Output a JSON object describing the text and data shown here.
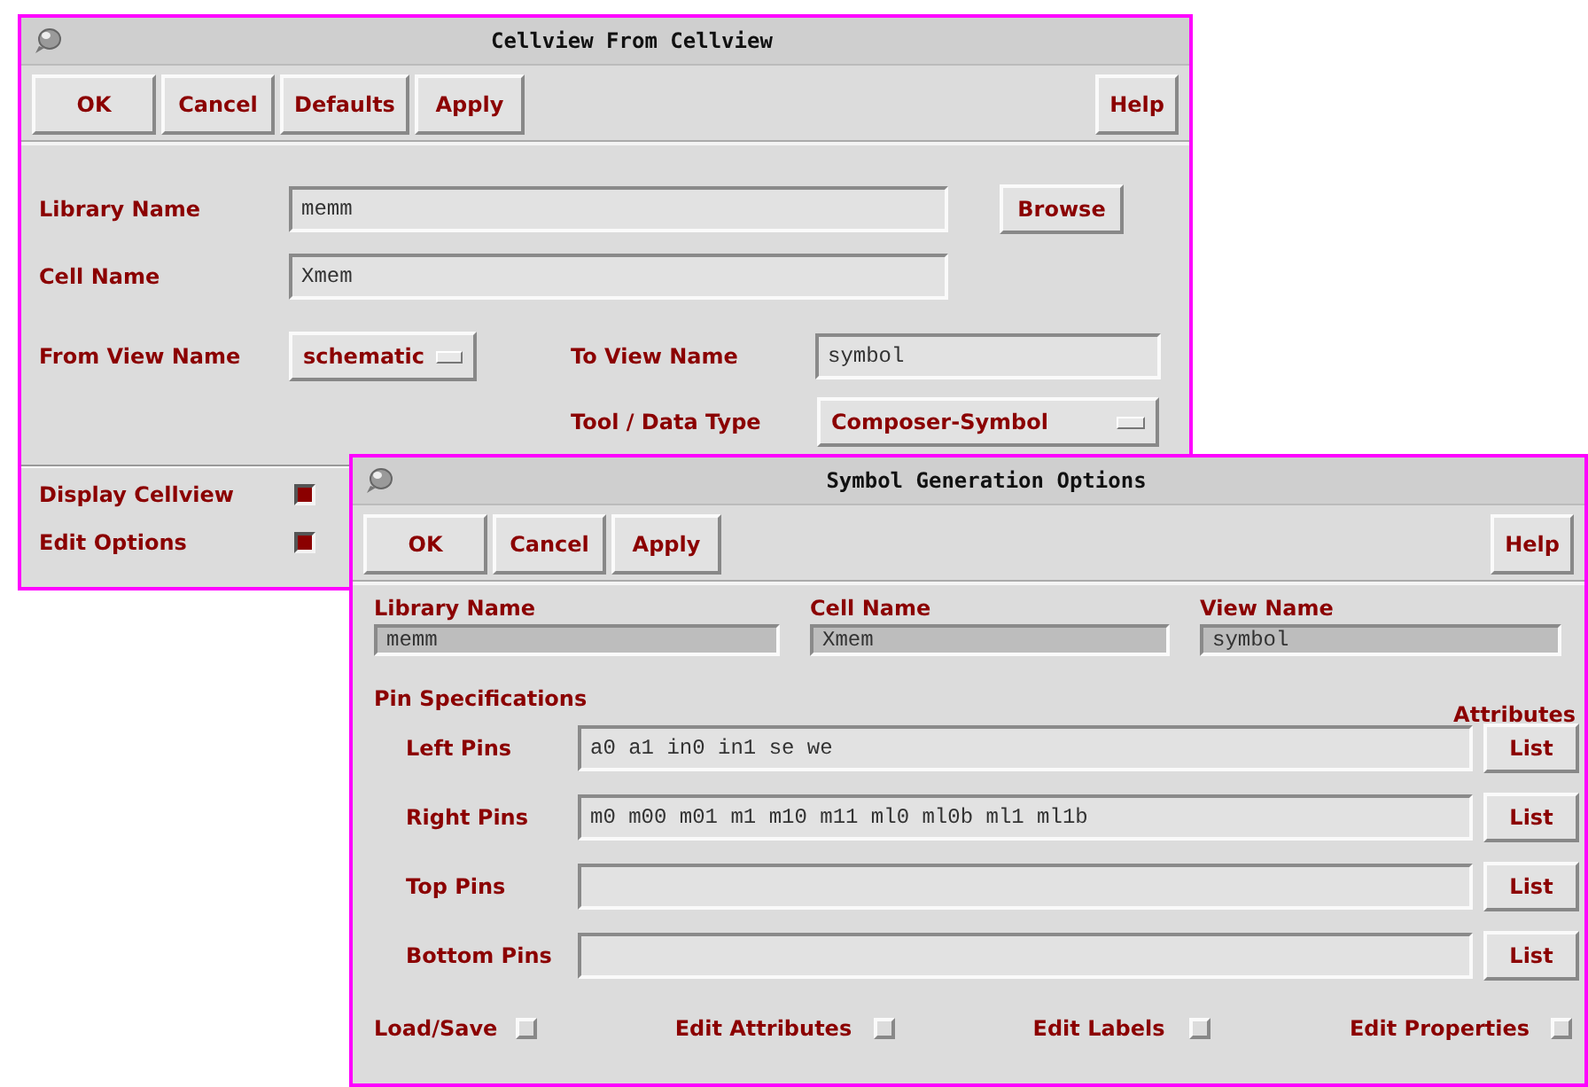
{
  "cellview_dialog": {
    "title": "Cellview From Cellview",
    "buttons": [
      "OK",
      "Cancel",
      "Defaults",
      "Apply"
    ],
    "help_button": "Help",
    "library_name": {
      "label": "Library Name",
      "value": "memm"
    },
    "browse_button": "Browse",
    "cell_name": {
      "label": "Cell Name",
      "value": "Xmem"
    },
    "from_view_name": {
      "label": "From View Name",
      "value": "schematic"
    },
    "to_view_name": {
      "label": "To View Name",
      "value": "symbol"
    },
    "tool_data_type": {
      "label": "Tool / Data Type",
      "value": "Composer-Symbol"
    },
    "options": [
      {
        "label": "Display Cellview",
        "checked": true
      },
      {
        "label": "Edit Options",
        "checked": true
      }
    ]
  },
  "symbol_dialog": {
    "title": "Symbol Generation Options",
    "buttons": [
      "OK",
      "Cancel",
      "Apply"
    ],
    "help_button": "Help",
    "name_fields": [
      {
        "label": "Library Name",
        "value": "memm",
        "readonly": true
      },
      {
        "label": "Cell Name",
        "value": "Xmem",
        "readonly": true
      },
      {
        "label": "View Name",
        "value": "symbol",
        "readonly": true
      }
    ],
    "pin_heading": "Pin Specifications",
    "attributes_heading": "Attributes",
    "pins": [
      {
        "label": "Left Pins",
        "value": "a0 a1 in0 in1 se we",
        "button": "List"
      },
      {
        "label": "Right Pins",
        "value": "m0 m00 m01 m1 m10 m11 ml0 ml0b ml1 ml1b",
        "button": "List"
      },
      {
        "label": "Top Pins",
        "button": "List"
      },
      {
        "label": "Bottom Pins",
        "button": "List"
      }
    ],
    "options": [
      {
        "label": "Load/Save",
        "checked": false
      },
      {
        "label": "Edit Attributes",
        "checked": false
      },
      {
        "label": "Edit Labels",
        "checked": false
      },
      {
        "label": "Edit Properties",
        "checked": false
      }
    ]
  }
}
